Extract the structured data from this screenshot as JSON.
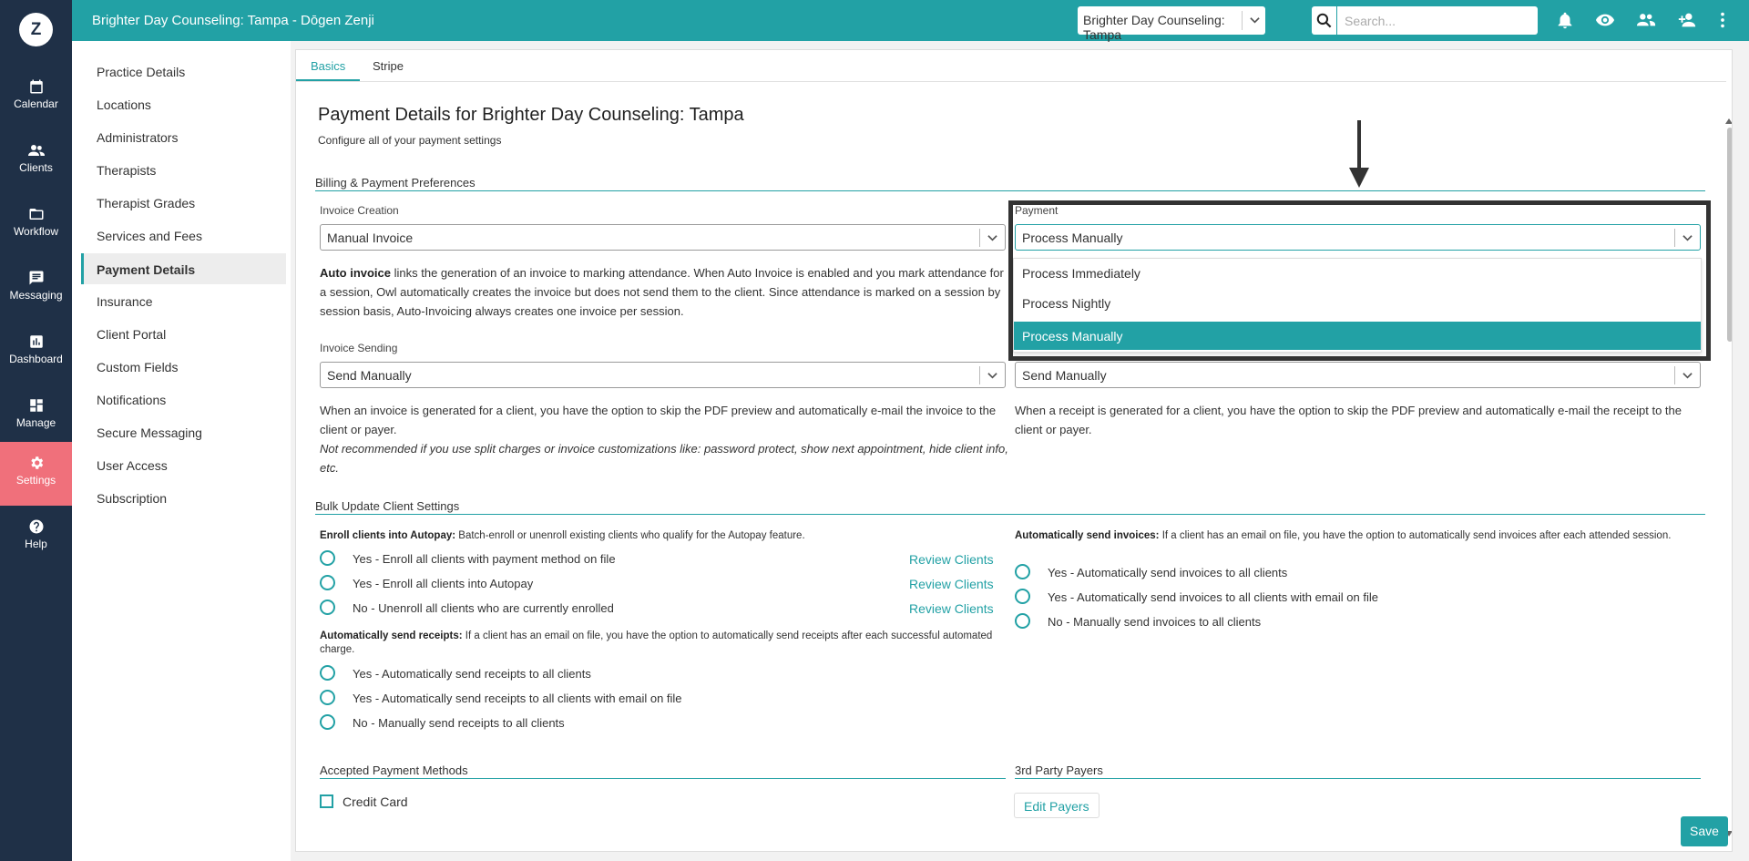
{
  "colors": {
    "teal": "#22a1a5",
    "navy": "#1f3047",
    "active_nav": "#f0707b"
  },
  "app": {
    "title": "Brighter Day Counseling: Tampa - Dōgen Zenji",
    "logo": "Z",
    "practice_select": "Brighter Day Counseling: Tampa",
    "search_placeholder": "Search..."
  },
  "topbar_icons": [
    "bell-icon",
    "eye-icon",
    "people-icon",
    "add-person-icon",
    "more-vertical-icon"
  ],
  "nav": [
    {
      "label": "Calendar",
      "icon": "calendar-icon"
    },
    {
      "label": "Clients",
      "icon": "clients-icon"
    },
    {
      "label": "Workflow",
      "icon": "folder-icon"
    },
    {
      "label": "Messaging",
      "icon": "message-icon"
    },
    {
      "label": "Dashboard",
      "icon": "chart-icon"
    },
    {
      "label": "Manage",
      "icon": "grid-icon"
    },
    {
      "label": "Settings",
      "icon": "gear-icon",
      "active": true
    },
    {
      "label": "Help",
      "icon": "help-icon"
    }
  ],
  "submenu": [
    "Practice Details",
    "Locations",
    "Administrators",
    "Therapists",
    "Therapist Grades",
    "Services and Fees",
    "Payment Details",
    "Insurance",
    "Client Portal",
    "Custom Fields",
    "Notifications",
    "Secure Messaging",
    "User Access",
    "Subscription"
  ],
  "submenu_active": "Payment Details",
  "tabs": [
    "Basics",
    "Stripe"
  ],
  "page": {
    "title": "Payment Details for Brighter Day Counseling: Tampa",
    "subtitle": "Configure all of your payment settings"
  },
  "billing": {
    "section_title": "Billing & Payment Preferences",
    "invoice_creation_label": "Invoice Creation",
    "invoice_creation_value": "Manual Invoice",
    "auto_invoice_bold": "Auto invoice",
    "auto_invoice_text": " links the generation of an invoice to marking attendance. When Auto Invoice is enabled and you mark attendance for a session, Owl automatically creates the invoice but does not send them to the client. Since attendance is marked on a session by session basis, Auto-Invoicing always creates one invoice per session.",
    "payment_label": "Payment",
    "payment_value": "Process Manually",
    "payment_options": [
      "Process Immediately",
      "Process Nightly",
      "Process Manually"
    ],
    "payment_selected": "Process Manually",
    "invoice_sending_label": "Invoice Sending",
    "invoice_sending_value": "Send Manually",
    "receipt_sending_value": "Send Manually",
    "invoice_sending_text": "When an invoice is generated for a client, you have the option to skip the PDF preview and automatically e-mail the invoice to the client or payer.",
    "invoice_sending_note": "Not recommended if you use split charges or invoice customizations like: password protect, show next appointment, hide client info, etc.",
    "receipt_sending_text": "When a receipt is generated for a client, you have the option to skip the PDF preview and automatically e-mail the receipt to the client or payer."
  },
  "bulk": {
    "section_title": "Bulk Update Client Settings",
    "autopay_bold": "Enroll clients into Autopay:",
    "autopay_text": " Batch-enroll or unenroll existing clients who qualify for the Autopay feature.",
    "autopay_options": [
      {
        "label": "Yes - Enroll all clients with payment method on file",
        "link": "Review Clients"
      },
      {
        "label": "Yes - Enroll all clients into Autopay",
        "link": "Review Clients"
      },
      {
        "label": "No - Unenroll all clients who are currently enrolled",
        "link": "Review Clients"
      }
    ],
    "receipts_bold": "Automatically send receipts:",
    "receipts_text": " If a client has an email on file, you have the option to automatically send receipts after each successful automated charge.",
    "receipts_options": [
      "Yes - Automatically send receipts to all clients",
      "Yes - Automatically send receipts to all clients with email on file",
      "No - Manually send receipts to all clients"
    ],
    "invoices_bold": "Automatically send invoices:",
    "invoices_text": " If a client has an email on file, you have the option to automatically send invoices after each attended session.",
    "invoices_options": [
      "Yes - Automatically send invoices to all clients",
      "Yes - Automatically send invoices to all clients with email on file",
      "No - Manually send invoices to all clients"
    ]
  },
  "methods": {
    "section_title": "Accepted Payment Methods",
    "credit_card": "Credit Card",
    "third_party_title": "3rd Party Payers",
    "edit_payers": "Edit Payers"
  },
  "save_label": "Save"
}
